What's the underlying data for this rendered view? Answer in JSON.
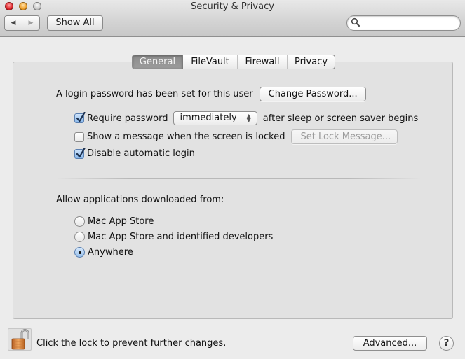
{
  "window": {
    "title": "Security & Privacy",
    "controls": [
      "close",
      "minimize",
      "zoom"
    ]
  },
  "toolbar": {
    "back_icon": "◀",
    "forward_icon": "▶",
    "show_all_label": "Show All",
    "search": {
      "value": "",
      "placeholder": ""
    }
  },
  "tabs": [
    {
      "label": "General",
      "active": true
    },
    {
      "label": "FileVault",
      "active": false
    },
    {
      "label": "Firewall",
      "active": false
    },
    {
      "label": "Privacy",
      "active": false
    }
  ],
  "general": {
    "login_password_text": "A login password has been set for this user",
    "change_password_label": "Change Password...",
    "require_password": {
      "checked": true,
      "label": "Require password",
      "popup_value": "immediately",
      "suffix": "after sleep or screen saver begins"
    },
    "show_message": {
      "checked": false,
      "label": "Show a message when the screen is locked",
      "button_label": "Set Lock Message...",
      "button_enabled": false
    },
    "disable_auto_login": {
      "checked": true,
      "label": "Disable automatic login"
    },
    "allow_apps_heading": "Allow applications downloaded from:",
    "allow_apps_options": [
      {
        "label": "Mac App Store",
        "selected": false
      },
      {
        "label": "Mac App Store and identified developers",
        "selected": false
      },
      {
        "label": "Anywhere",
        "selected": true
      }
    ]
  },
  "footer": {
    "lock_state": "unlocked",
    "lock_text": "Click the lock to prevent further changes.",
    "advanced_label": "Advanced...",
    "help_label": "?"
  },
  "colors": {
    "checkbox_accent": "#87b6ea",
    "active_tab": "#929292",
    "window_bg": "#ececec",
    "panel_bg": "#e2e2e2"
  }
}
